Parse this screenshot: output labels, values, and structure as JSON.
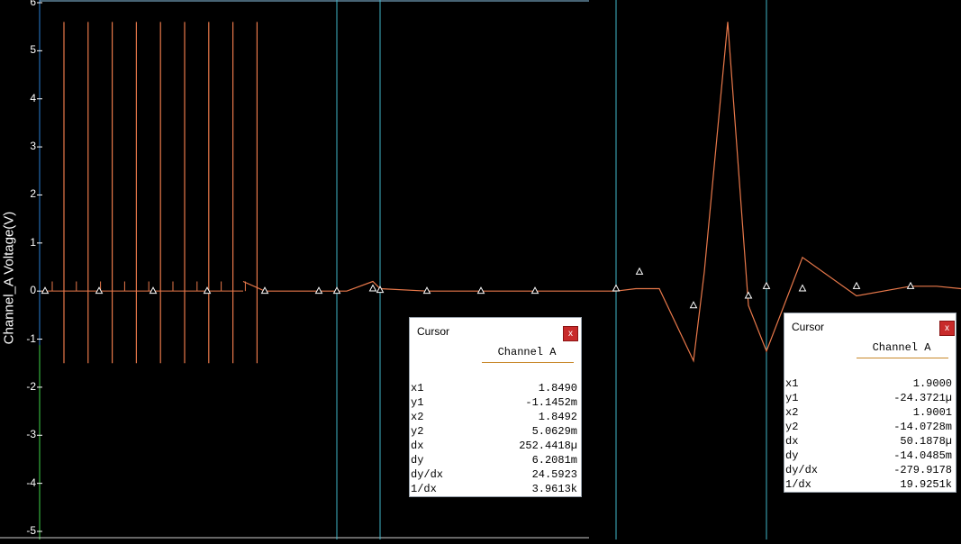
{
  "chart_data": {
    "type": "line",
    "ylabel": "Channel_A Voltage(V)",
    "ylim": [
      -5,
      6
    ],
    "y_ticks": [
      "6",
      "5",
      "4",
      "3",
      "2",
      "1",
      "0",
      "-1",
      "-2",
      "-3",
      "-4",
      "-5"
    ],
    "grid": false,
    "series": [
      {
        "name": "Channel A",
        "color": "#e8784a",
        "y": [
          0,
          0.2,
          5.6,
          -1.5,
          0.2,
          5.6,
          -1.5,
          0.2,
          5.6,
          -1.5,
          0.2,
          5.6,
          -1.5,
          0.2,
          5.6,
          -1.5,
          0.2,
          5.6,
          -1.5,
          0.2,
          5.6,
          -1.5,
          0.2,
          5.6,
          -1.5,
          0.2,
          5.6,
          -1.5,
          0.2,
          0,
          0,
          0,
          0,
          0.2,
          0.05,
          0,
          0,
          0,
          0,
          0,
          0,
          0.05,
          0.05,
          0.05,
          -1.45,
          0.4,
          5.6,
          -0.3,
          -1.25,
          0.7,
          -0.1,
          0.1,
          0.1,
          0.05,
          0.05,
          0.1,
          0.1,
          0.05,
          0.05,
          0.05
        ]
      }
    ]
  },
  "cursor_panels": [
    {
      "title": "Cursor",
      "close_label": "x",
      "channel": "Channel A",
      "rows": [
        {
          "k": "x1",
          "v": "1.8490"
        },
        {
          "k": "y1",
          "v": "-1.1452m"
        },
        {
          "k": "x2",
          "v": "1.8492"
        },
        {
          "k": "y2",
          "v": "5.0629m"
        },
        {
          "k": "dx",
          "v": "252.4418µ"
        },
        {
          "k": "dy",
          "v": "6.2081m"
        },
        {
          "k": "dy/dx",
          "v": "24.5923"
        },
        {
          "k": "1/dx",
          "v": "3.9613k"
        }
      ]
    },
    {
      "title": "Cursor",
      "close_label": "x",
      "channel": "Channel A",
      "rows": [
        {
          "k": "x1",
          "v": "1.9000"
        },
        {
          "k": "y1",
          "v": "-24.3721µ"
        },
        {
          "k": "x2",
          "v": "1.9001"
        },
        {
          "k": "y2",
          "v": "-14.0728m"
        },
        {
          "k": "dx",
          "v": "50.1878µ"
        },
        {
          "k": "dy",
          "v": "-14.0485m"
        },
        {
          "k": "dy/dx",
          "v": "-279.9178"
        },
        {
          "k": "1/dx",
          "v": "19.9251k"
        }
      ]
    }
  ],
  "colors": {
    "trace": "#e8784a",
    "cursor_line": "#3fb6c8",
    "background": "#000000",
    "axis": "#ffffff"
  }
}
